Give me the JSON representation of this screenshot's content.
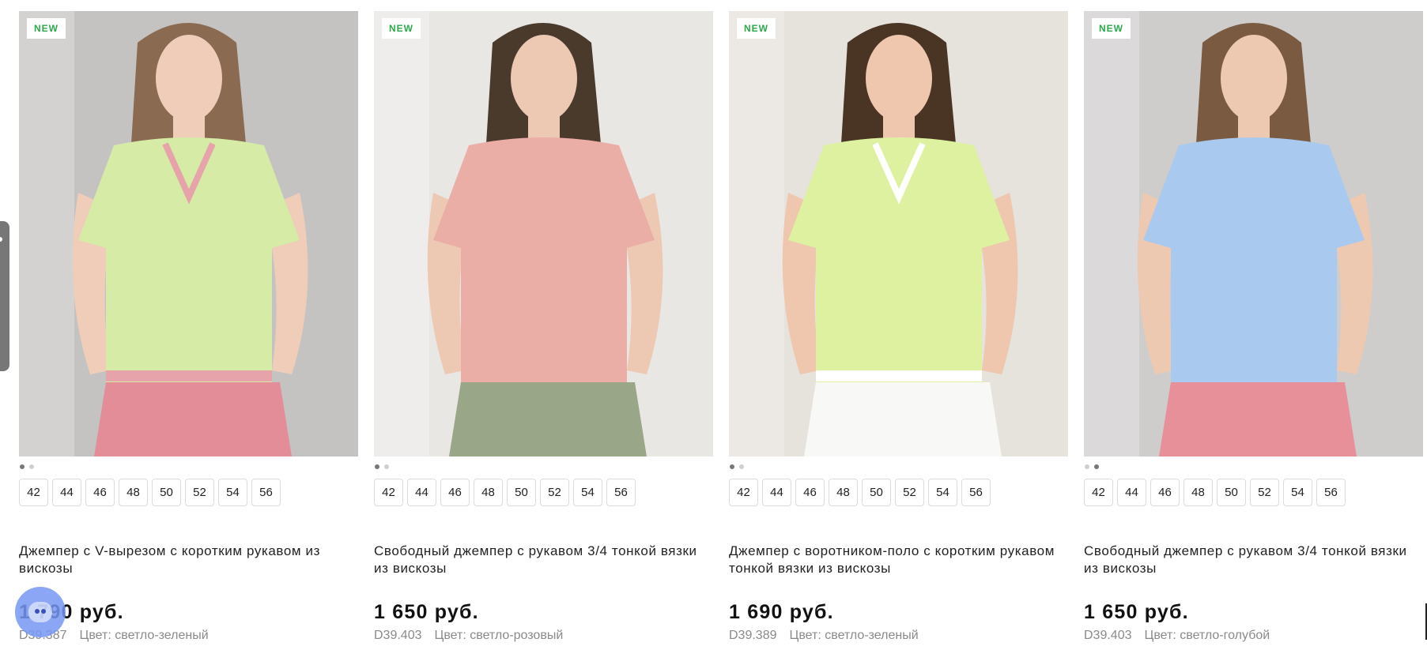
{
  "badge_label": "NEW",
  "products": [
    {
      "name": "Джемпер с V-вырезом с коротким рукавом из вискозы",
      "price": "1 790 руб.",
      "sku": "D39.387",
      "color_label": "Цвет: светло-зеленый",
      "sizes": [
        "42",
        "44",
        "46",
        "48",
        "50",
        "52",
        "54",
        "56"
      ],
      "image_dots_active": 0,
      "palette": {
        "bg": "#c5c3c2",
        "top": "#d6eba6",
        "trim": "#e7a3aa",
        "bottom": "#e28d98",
        "hair": "#8a6a50",
        "skin": "#f0cdb8"
      }
    },
    {
      "name": "Свободный джемпер с рукавом 3/4 тонкой вязки из вискозы",
      "price": "1 650 руб.",
      "sku": "D39.403",
      "color_label": "Цвет: светло-розовый",
      "sizes": [
        "42",
        "44",
        "46",
        "48",
        "50",
        "52",
        "54",
        "56"
      ],
      "image_dots_active": 0,
      "palette": {
        "bg": "#e9e7e4",
        "top": "#eaaea7",
        "trim": "#eaaea7",
        "bottom": "#9aa688",
        "hair": "#4a3a2c",
        "skin": "#edc9b4"
      }
    },
    {
      "name": "Джемпер с воротником-поло с коротким рукавом тонкой вязки из вискозы",
      "price": "1 690 руб.",
      "sku": "D39.389",
      "color_label": "Цвет: светло-зеленый",
      "sizes": [
        "42",
        "44",
        "46",
        "48",
        "50",
        "52",
        "54",
        "56"
      ],
      "image_dots_active": 0,
      "palette": {
        "bg": "#e6e2dc",
        "top": "#ddf1a0",
        "trim": "#ffffff",
        "bottom": "#f8f8f6",
        "hair": "#4a3424",
        "skin": "#eec7ae"
      }
    },
    {
      "name": "Свободный джемпер с рукавом 3/4 тонкой вязки из вискозы",
      "price": "1 650 руб.",
      "sku": "D39.403",
      "color_label": "Цвет: светло-голубой",
      "sizes": [
        "42",
        "44",
        "46",
        "48",
        "50",
        "52",
        "54",
        "56"
      ],
      "image_dots_active": 1,
      "palette": {
        "bg": "#cfcdcc",
        "top": "#a9c9ee",
        "trim": "#a9c9ee",
        "bottom": "#e7909a",
        "hair": "#7a5a40",
        "skin": "#eec9b2"
      }
    }
  ]
}
